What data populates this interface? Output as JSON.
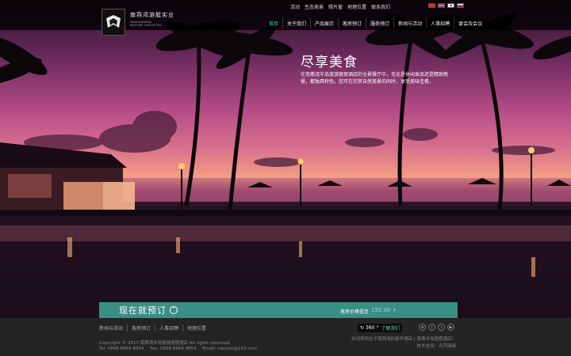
{
  "brand": {
    "name_cn": "南燕湾游艇实业",
    "name_en_line1": "NANYANWAN",
    "name_en_line2": "MARINE INDUSTRY"
  },
  "utility_links": [
    "活动",
    "生态美景",
    "照片窗",
    "地理位置",
    "联系我们"
  ],
  "main_nav": [
    "首页",
    "关于我们",
    "产品展示",
    "客房预订",
    "服务预订",
    "新闻与活动",
    "人事招聘",
    "宴会及会议"
  ],
  "hero": {
    "title": "尽享美食",
    "description": "在南燕湾半岛旅游度假酒店的全景餐厅中，无论是休闲食品还是精致晚餐，都独具特色。您可在欣赏自然美景的同时，享受美味佳肴。"
  },
  "booking": {
    "title": "现在就预订",
    "price_label": "客房价格低至",
    "price_value": "155.00"
  },
  "footer": {
    "links": [
      "新闻与活动",
      "客房预订",
      "人事招聘",
      "地理位置"
    ],
    "copyright": "Copyright © 2013 南燕湾半岛旅游度假酒店 All rights reserved.",
    "tel": "Tel: 0898 8864 8854",
    "fax": "Fax: 0898 8864 8854",
    "email": "Email: nanyan@163.com",
    "vr_label": "360 °",
    "vr_link": "了解我们",
    "right_line1": "欢迎来到位于南燕湾的豪华酒店 | 南燕半岛度假酒店！",
    "right_line2": "技术支持：光芒网络"
  },
  "colors": {
    "accent": "#3ccba6",
    "booking_bar": "#3a8f85",
    "topbar": "#000000",
    "footer": "#242424"
  }
}
